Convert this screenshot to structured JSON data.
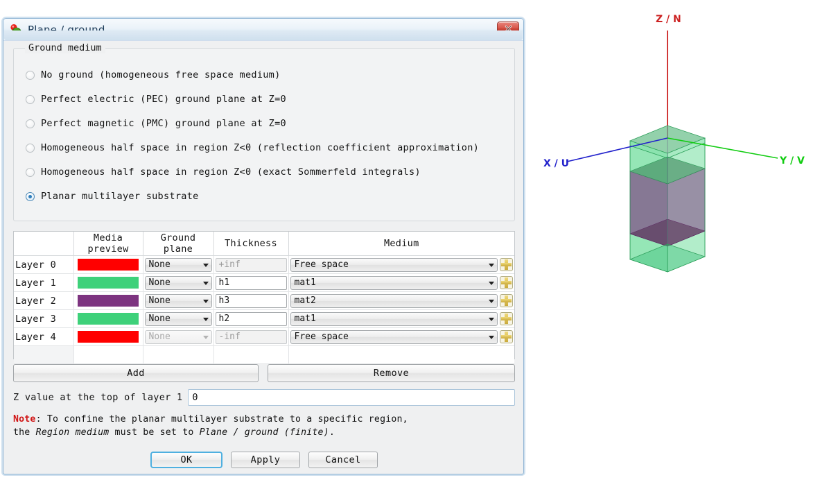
{
  "dialog": {
    "title": "Plane / ground",
    "icon": "plane-ground-icon",
    "close_label": "close-icon"
  },
  "groupbox": {
    "title": "Ground medium",
    "options": [
      {
        "label": "No ground (homogeneous free space medium)",
        "selected": false
      },
      {
        "label": "Perfect electric (PEC) ground plane at Z=0",
        "selected": false
      },
      {
        "label": "Perfect magnetic (PMC) ground plane at Z=0",
        "selected": false
      },
      {
        "label": "Homogeneous half space in region Z<0 (reflection coefficient approximation)",
        "selected": false
      },
      {
        "label": "Homogeneous half space in region Z<0 (exact Sommerfeld integrals)",
        "selected": false
      },
      {
        "label": "Planar multilayer substrate",
        "selected": true
      }
    ]
  },
  "table": {
    "headers": [
      "",
      "Media preview",
      "Ground plane",
      "Thickness",
      "Medium"
    ],
    "rows": [
      {
        "name": "Layer 0",
        "color": "#ff0000",
        "ground_plane": "None",
        "gp_disabled": false,
        "thickness": "+inf",
        "th_disabled": true,
        "medium": "Free space"
      },
      {
        "name": "Layer 1",
        "color": "#3ed17a",
        "ground_plane": "None",
        "gp_disabled": false,
        "thickness": "h1",
        "th_disabled": false,
        "medium": "mat1"
      },
      {
        "name": "Layer 2",
        "color": "#7d3480",
        "ground_plane": "None",
        "gp_disabled": false,
        "thickness": "h3",
        "th_disabled": false,
        "medium": "mat2"
      },
      {
        "name": "Layer 3",
        "color": "#3ed17a",
        "ground_plane": "None",
        "gp_disabled": false,
        "thickness": "h2",
        "th_disabled": false,
        "medium": "mat1"
      },
      {
        "name": "Layer 4",
        "color": "#ff0000",
        "ground_plane": "None",
        "gp_disabled": true,
        "thickness": "-inf",
        "th_disabled": true,
        "medium": "Free space"
      }
    ]
  },
  "actions": {
    "add": "Add",
    "remove": "Remove"
  },
  "zvalue": {
    "label": "Z value at the top of layer 1",
    "value": "0"
  },
  "note": {
    "prefix": "Note",
    "colon": ":",
    "line1_a": " To confine the planar multilayer substrate to a specific region,",
    "line2_a": "the ",
    "line2_em1": "Region medium",
    "line2_b": " must be set to ",
    "line2_em2": "Plane / ground (finite)",
    "line2_c": "."
  },
  "buttons": {
    "ok": "OK",
    "apply": "Apply",
    "cancel": "Cancel"
  },
  "view3d": {
    "axes": [
      {
        "name": "z-axis",
        "label": "Z / N",
        "color": "#cc2222"
      },
      {
        "name": "x-axis",
        "label": "X / U",
        "color": "#2222cc"
      },
      {
        "name": "y-axis",
        "label": "Y / V",
        "color": "#11cc11"
      }
    ],
    "bands": [
      {
        "material": "mat1",
        "color": "#3ed17a"
      },
      {
        "material": "mat2",
        "color": "#7d3480"
      },
      {
        "material": "mat1",
        "color": "#3ed17a"
      }
    ]
  }
}
